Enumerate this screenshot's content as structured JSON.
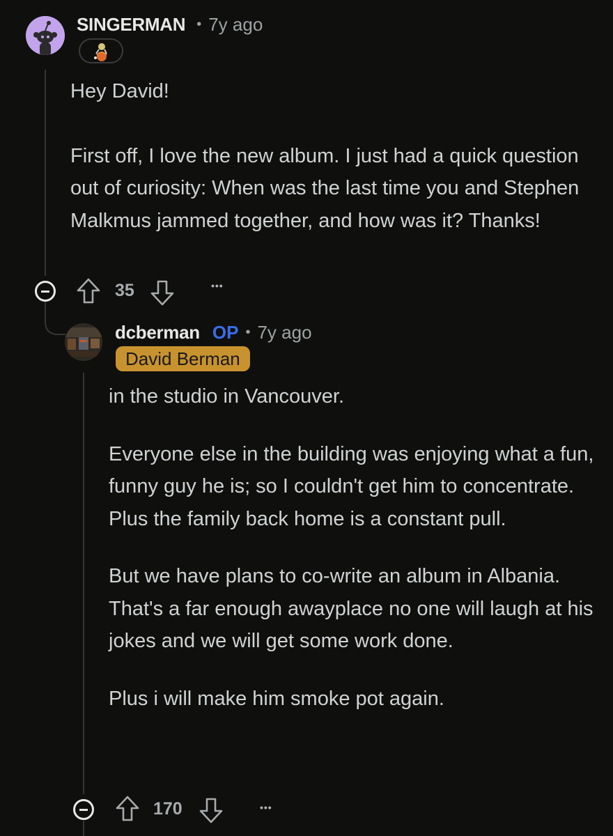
{
  "comment": {
    "author": "SINGERMAN",
    "separator": "•",
    "time": "7y ago",
    "paragraphs": [
      "Hey David!",
      "First off, I love the new album. I just had a quick question out of curiosity: When was the last time you and Stephen Malkmus jammed together, and how was it? Thanks!"
    ],
    "score": "35",
    "more": "•••"
  },
  "reply": {
    "author": "dcberman",
    "op_badge": "OP",
    "separator": "•",
    "time": "7y ago",
    "flair": "David Berman",
    "paragraphs": [
      "in the studio in Vancouver.",
      "Everyone else in the building was enjoying what a fun, funny guy he is; so I couldn't get him to concentrate. Plus the family back home is a constant pull.",
      "But we have plans to co-write an album in Albania. That's a far enough awayplace no one will laugh at his jokes and we will get some work done.",
      "Plus i will make him smoke pot again."
    ],
    "score": "170",
    "more": "•••"
  },
  "colors": {
    "background": "#0f0f0d",
    "op_badge": "#3a6ee8",
    "flair_background": "#c8932e",
    "avatar_background": "#c3a4ec"
  },
  "icons": {
    "upvote": "arrow-up-outline-icon",
    "downvote": "arrow-down-outline-icon",
    "collapse": "collapse-minus-icon",
    "more": "more-options-icon"
  }
}
